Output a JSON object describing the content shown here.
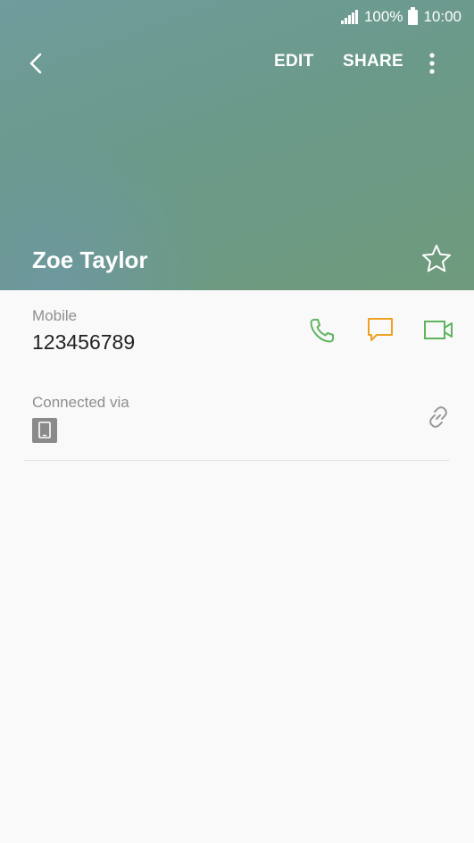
{
  "status_bar": {
    "battery": "100%",
    "time": "10:00"
  },
  "toolbar": {
    "edit_label": "EDIT",
    "share_label": "SHARE"
  },
  "contact": {
    "name": "Zoe Taylor",
    "phone_label": "Mobile",
    "phone_number": "123456789",
    "connected_label": "Connected via"
  },
  "colors": {
    "call": "#5fb55f",
    "message": "#f0a020",
    "video": "#5fb55f",
    "link": "#9a9a9a",
    "device": "#8a8a8a"
  },
  "icons": [
    "back-arrow-icon",
    "more-vertical-icon",
    "star-icon",
    "phone-icon",
    "message-icon",
    "video-icon",
    "tablet-icon",
    "link-icon",
    "signal-icon",
    "battery-icon"
  ]
}
